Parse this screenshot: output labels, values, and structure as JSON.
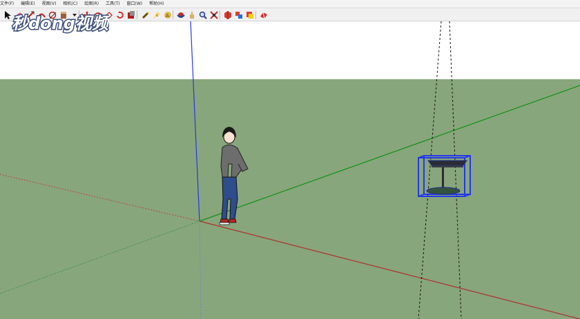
{
  "menu": {
    "items": [
      {
        "label": "文件(F)"
      },
      {
        "label": "编辑(E)"
      },
      {
        "label": "视图(V)"
      },
      {
        "label": "相机(C)"
      },
      {
        "label": "绘图(R)"
      },
      {
        "label": "工具(T)"
      },
      {
        "label": "窗口(W)"
      },
      {
        "label": "帮助(H)"
      }
    ]
  },
  "toolbar": {
    "tools": [
      "select-icon",
      "eraser-icon",
      "line-icon",
      "arc-icon",
      "rectangle-icon",
      "push-pull-icon",
      "move-icon",
      "rotate-icon",
      "offset-icon",
      "follow-me-icon",
      "scale-icon",
      "paint-bucket-icon",
      "tape-measure-icon",
      "text-icon",
      "orbit-icon",
      "pan-icon",
      "zoom-icon",
      "zoom-extents-icon",
      "components-icon",
      "styles-icon",
      "layers-icon",
      "warehouse-icon"
    ]
  },
  "watermark": {
    "text": "秒dong视频"
  },
  "scene": {
    "colors": {
      "sky": "#ffffff",
      "ground": "#88a67b",
      "axis_red": "#ad2f2f",
      "axis_green": "#0f9115",
      "axis_blue": "#2238e4",
      "selection_blue": "#2438e8"
    },
    "model": {
      "name": "Table",
      "selected": true
    },
    "figure": {
      "name": "Scale Figure"
    }
  }
}
